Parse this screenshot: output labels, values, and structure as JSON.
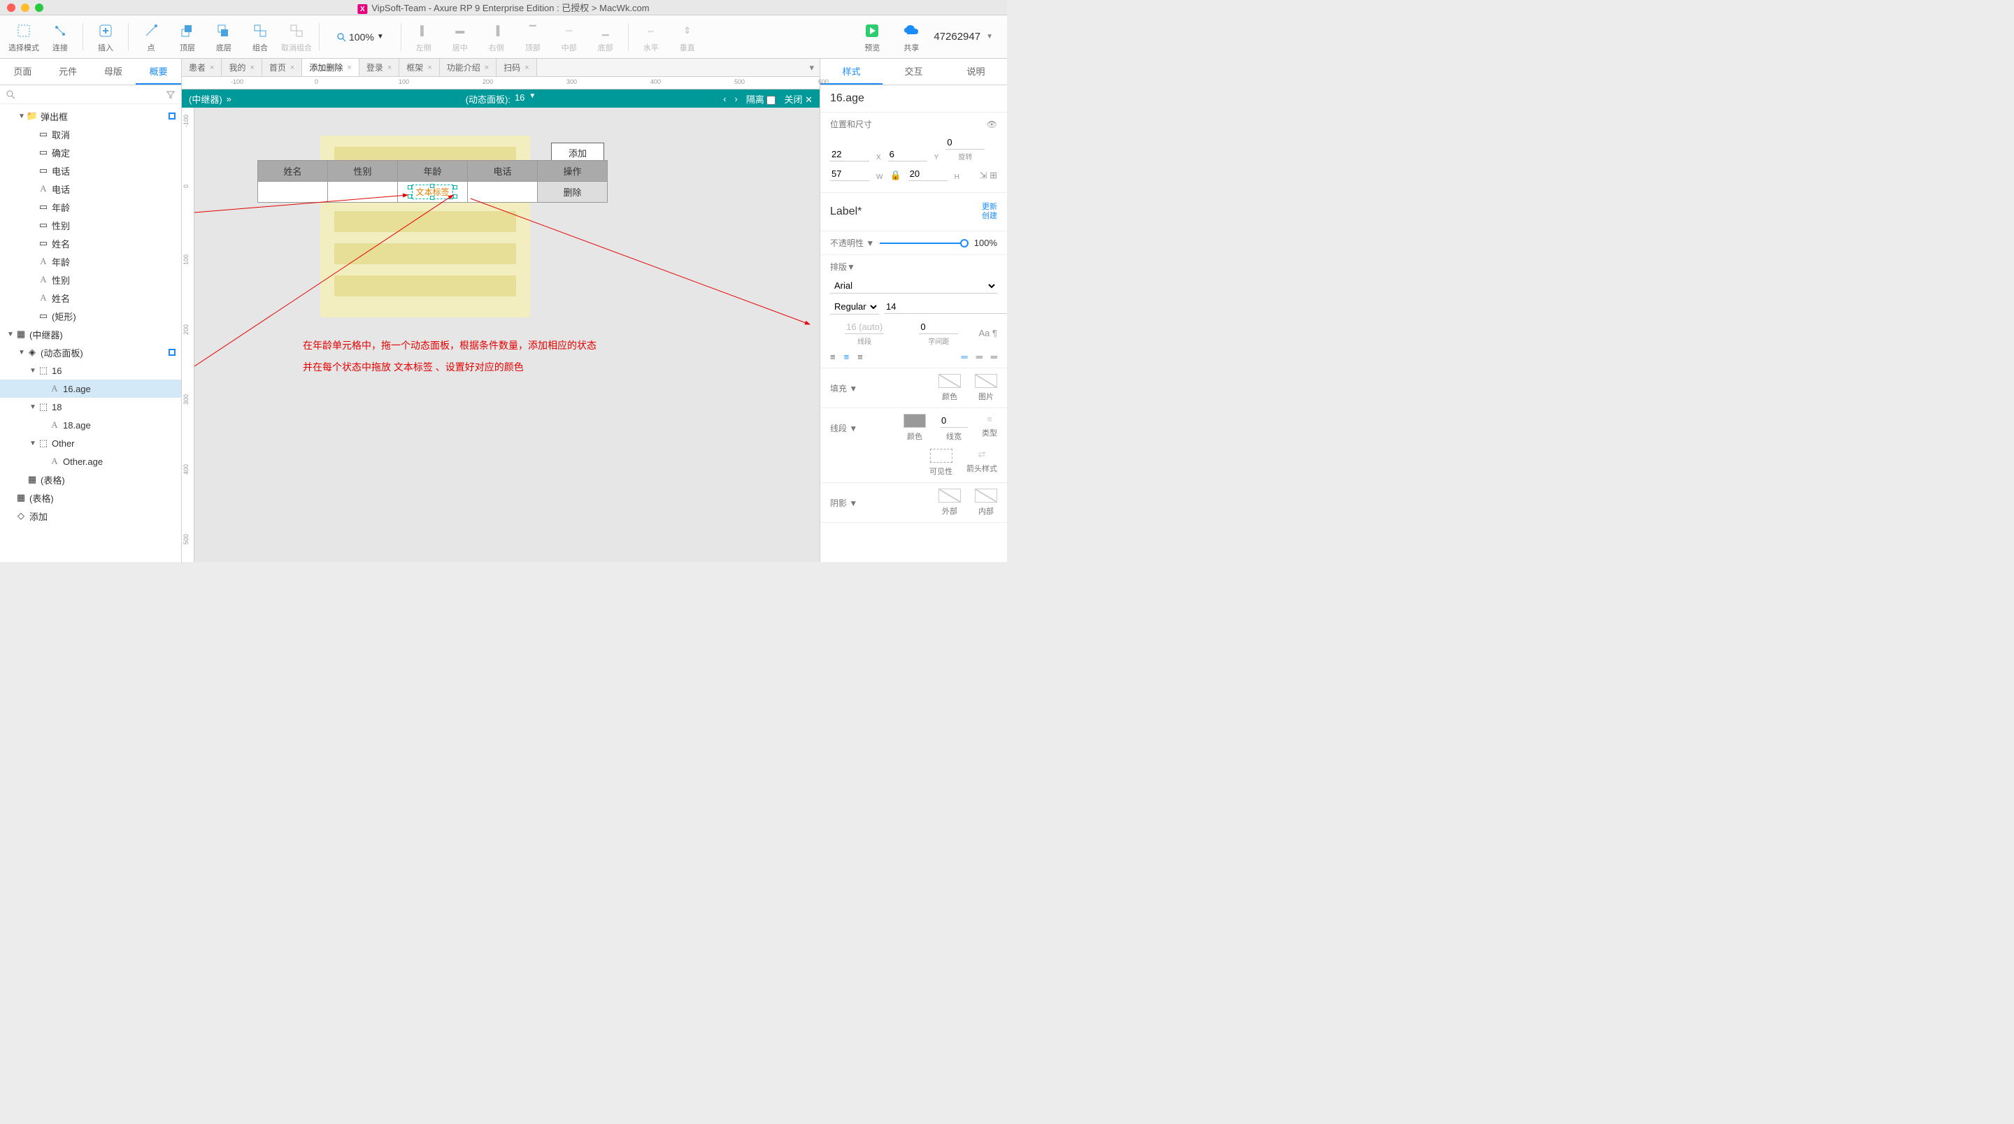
{
  "window": {
    "title": "VipSoft-Team - Axure RP 9 Enterprise Edition : 已授权 > MacWk.com"
  },
  "toolbar": {
    "select_mode": "选择模式",
    "connect": "连接",
    "insert": "插入",
    "point": "点",
    "top": "顶层",
    "bottom": "底层",
    "group": "组合",
    "ungroup": "取消组合",
    "align_left": "左侧",
    "align_center": "居中",
    "align_right": "右侧",
    "align_top": "顶部",
    "align_middle": "中部",
    "align_bottom": "底部",
    "dist_h": "水平",
    "dist_v": "垂直",
    "preview": "预览",
    "share": "共享",
    "zoom": "100%",
    "account": "47262947"
  },
  "left_tabs": {
    "page": "页面",
    "widget": "元件",
    "master": "母版",
    "outline": "概要"
  },
  "outline": [
    {
      "pad": 1,
      "carr": "▼",
      "ic": "folder",
      "name": "弹出框",
      "sq": true
    },
    {
      "pad": 2,
      "ic": "rect",
      "name": "取消"
    },
    {
      "pad": 2,
      "ic": "rect",
      "name": "确定"
    },
    {
      "pad": 2,
      "ic": "rect",
      "name": "电话"
    },
    {
      "pad": 2,
      "ic": "text",
      "name": "电话"
    },
    {
      "pad": 2,
      "ic": "rect",
      "name": "年龄"
    },
    {
      "pad": 2,
      "ic": "rect",
      "name": "性别"
    },
    {
      "pad": 2,
      "ic": "rect",
      "name": "姓名"
    },
    {
      "pad": 2,
      "ic": "text",
      "name": "年龄"
    },
    {
      "pad": 2,
      "ic": "text",
      "name": "性别"
    },
    {
      "pad": 2,
      "ic": "text",
      "name": "姓名"
    },
    {
      "pad": 2,
      "ic": "rect",
      "name": "(矩形)"
    },
    {
      "pad": 0,
      "carr": "▼",
      "ic": "grid",
      "name": "(中继器)"
    },
    {
      "pad": 1,
      "carr": "▼",
      "ic": "layers",
      "name": "(动态面板)",
      "sq": true
    },
    {
      "pad": 2,
      "carr": "▼",
      "ic": "dash",
      "name": "16"
    },
    {
      "pad": 3,
      "ic": "text",
      "name": "16.age",
      "sel": true
    },
    {
      "pad": 2,
      "carr": "▼",
      "ic": "dash",
      "name": "18"
    },
    {
      "pad": 3,
      "ic": "text",
      "name": "18.age"
    },
    {
      "pad": 2,
      "carr": "▼",
      "ic": "dash",
      "name": "Other"
    },
    {
      "pad": 3,
      "ic": "text",
      "name": "Other.age"
    },
    {
      "pad": 1,
      "ic": "grid",
      "name": "(表格)"
    },
    {
      "pad": 0,
      "ic": "grid",
      "name": "(表格)"
    },
    {
      "pad": 0,
      "ic": "diamond",
      "name": "添加"
    }
  ],
  "doc_tabs": [
    "患者",
    "我的",
    "首页",
    "添加删除",
    "登录",
    "框架",
    "功能介绍",
    "扫码"
  ],
  "doc_active": 3,
  "dpbar": {
    "left": "(中继器)",
    "arrow": "»",
    "center_label": "(动态面板):",
    "center_state": "16",
    "prev": "‹",
    "next": "›",
    "isolate": "隔离",
    "close": "关闭"
  },
  "canvas": {
    "add_btn": "添加",
    "headers": [
      "姓名",
      "性别",
      "年龄",
      "电话",
      "操作"
    ],
    "delete_btn": "删除",
    "sel_label": "文本标签",
    "note1": "在年龄单元格中，拖一个动态面板，根据条件数量，添加相应的状态",
    "note2": "并在每个状态中拖放 文本标签 、设置好对应的颜色"
  },
  "right_tabs": {
    "style": "样式",
    "interact": "交互",
    "notes": "说明"
  },
  "inspector": {
    "name": "16.age",
    "pos_size": "位置和尺寸",
    "x": "22",
    "y": "6",
    "rot": "0",
    "rot_label": "旋转",
    "w": "57",
    "h": "20",
    "style_label": "Label*",
    "update": "更新",
    "create": "创建",
    "opacity_label": "不透明性",
    "opacity": "100%",
    "typo": "排版",
    "font": "Arial",
    "weight": "Regular",
    "size": "14",
    "color": "#e67e00",
    "line_h": "16 (auto)",
    "line_h_label": "线段",
    "letter": "0",
    "letter_label": "字间距",
    "fill": "填充",
    "fill_color": "颜色",
    "fill_image": "图片",
    "border": "线段",
    "border_color": "颜色",
    "border_w": "0",
    "border_w_label": "线宽",
    "border_type": "类型",
    "vis": "可见性",
    "arrow": "箭头样式",
    "shadow": "阴影",
    "shadow_out": "外部",
    "shadow_in": "内部"
  },
  "ruler_h": [
    "-100",
    "0",
    "100",
    "200",
    "300",
    "400",
    "500",
    "600"
  ],
  "ruler_v": [
    "-100",
    "0",
    "100",
    "200",
    "300",
    "400",
    "500"
  ]
}
